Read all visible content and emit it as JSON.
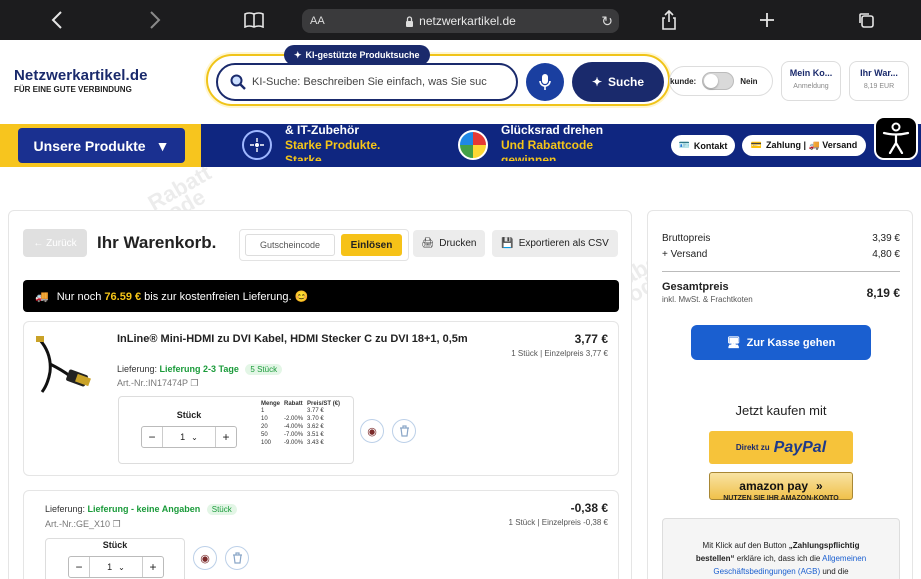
{
  "browser": {
    "text_size_label": "AA",
    "url": "netzwerkartikel.de"
  },
  "brand": {
    "name": "Netzwerkartikel.de",
    "tagline": "FÜR EINE GUTE VERBINDUNG",
    "accent": "#1a2a6c",
    "yellow": "#f6c218"
  },
  "search": {
    "badge": "KI-gestützte Produktsuche",
    "placeholder": "KI-Suche: Beschreiben Sie einfach, was Sie suc",
    "button": "Suche"
  },
  "header": {
    "toggle_label_fragment": "kunde:",
    "toggle_value": "Nein",
    "account_title": "Mein Ko...",
    "account_sub": "Anmeldung",
    "cart_title": "Ihr War...",
    "cart_sub": "8,19 EUR"
  },
  "nav": {
    "products_button": "Unsere Produkte",
    "promo1_line1": "& IT-Zubehör",
    "promo1_line2": "Starke Produkte.",
    "promo1_line3": "Starke",
    "promo2_line1": "Glücksrad drehen",
    "promo2_line2": "Und Rabattcode",
    "promo2_line3": "gewinnen",
    "contact": "Kontakt",
    "payment_shipping": "Zahlung | 🚚 Versand"
  },
  "cart": {
    "back": "← Zurück",
    "title": "Ihr Warenkorb.",
    "coupon_placeholder": "Gutscheincode",
    "redeem": "Einlösen",
    "print": "Drucken",
    "export": "Exportieren als CSV",
    "shipping_banner_pre": "Nur noch",
    "shipping_banner_amount": "76.59 €",
    "shipping_banner_post": "bis zur kostenfreien Lieferung. 😊"
  },
  "items": [
    {
      "name": "InLine® Mini-HDMI zu DVI Kabel, HDMI Stecker C zu DVI 18+1, 0,5m",
      "delivery_label": "Lieferung:",
      "delivery_value": "Lieferung 2-3 Tage",
      "stock": "5 Stück",
      "artno": "Art.-Nr.:IN17474P",
      "price": "3,77 €",
      "price_sub": "1 Stück | Einzelpreis 3,77 €",
      "qty_label": "Stück",
      "qty": "1",
      "tier_headers": [
        "Menge",
        "Rabatt",
        "Preis/ST (€)"
      ],
      "tiers": [
        [
          "1",
          "",
          "3.77 €"
        ],
        [
          "10",
          "-2.00%",
          "3.70 €"
        ],
        [
          "20",
          "-4.00%",
          "3.62 €"
        ],
        [
          "50",
          "-7.00%",
          "3.51 €"
        ],
        [
          "100",
          "-9.00%",
          "3.43 €"
        ]
      ]
    },
    {
      "delivery_label": "Lieferung:",
      "delivery_value": "Lieferung - keine Angaben",
      "stock": "Stück",
      "artno": "Art.-Nr.:GE_X10",
      "price": "-0,38 €",
      "price_sub": "1 Stück | Einzelpreis -0,38 €",
      "qty_label": "Stück",
      "qty": "1"
    }
  ],
  "summary": {
    "gross_label": "Bruttopreis",
    "gross_value": "3,39 €",
    "shipping_label": "+ Versand",
    "shipping_value": "4,80 €",
    "total_label": "Gesamtpreis",
    "total_sub": "inkl. MwSt. & Frachtkoten",
    "total_value": "8,19 €",
    "checkout": "Zur Kasse gehen",
    "buy_now": "Jetzt kaufen mit",
    "paypal_prefix": "Direkt zu",
    "paypal_brand": "PayPal",
    "amazon_brand": "amazon pay",
    "amazon_sub": "NUTZEN SIE IHR AMAZON-KONTO",
    "terms_1": "Mit Klick auf den Button ",
    "terms_bold1": "„Zahlungspflichtig",
    "terms_bold2": "bestellen“",
    "terms_2": " erkläre ich, dass ich die ",
    "terms_link1": "Allgemeinen",
    "terms_link2": "Geschäftsbedingungen (AGB)",
    "terms_3": " und die"
  }
}
